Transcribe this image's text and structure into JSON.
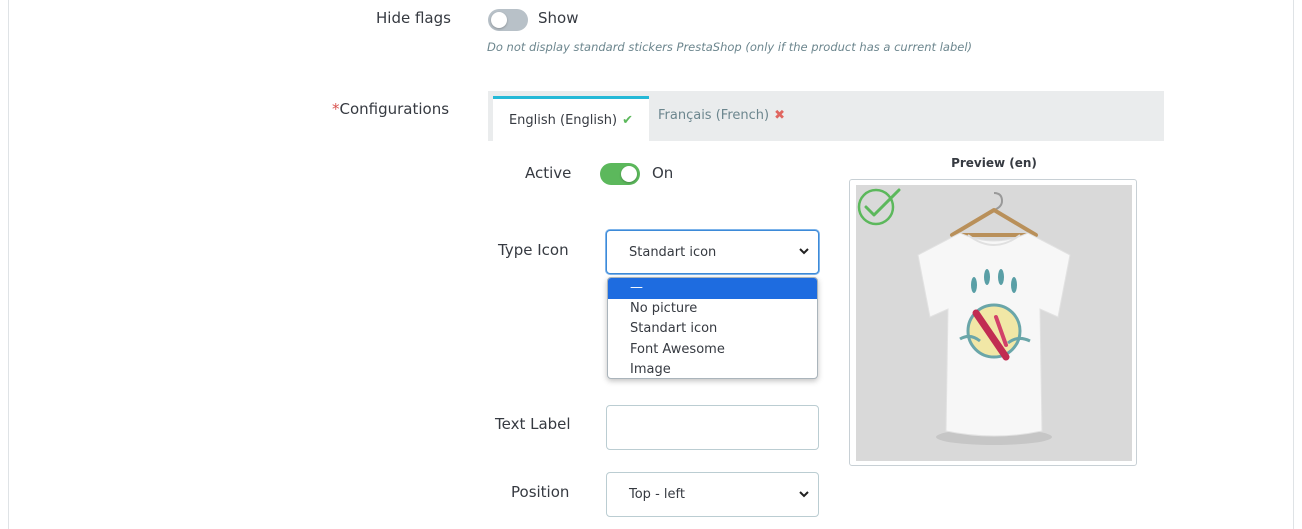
{
  "hide_flags": {
    "label": "Hide flags",
    "state_text": "Show",
    "help": "Do not display standard stickers PrestaShop (only if the product has a current label)"
  },
  "configurations": {
    "required_mark": "*",
    "label": "Configurations",
    "tabs": [
      {
        "label": "English (English)",
        "status": "✔",
        "active": true
      },
      {
        "label": "Français (French)",
        "status": "✖",
        "active": false
      }
    ]
  },
  "active": {
    "label": "Active",
    "state_text": "On"
  },
  "type_icon": {
    "label": "Type Icon",
    "selected": "Standart icon",
    "options": [
      "—",
      "No picture",
      "Standart icon",
      "Font Awesome",
      "Image"
    ]
  },
  "text_label": {
    "label": "Text Label",
    "value": ""
  },
  "position": {
    "label": "Position",
    "selected": "Top - left"
  },
  "preview": {
    "title": "Preview (en)"
  },
  "colors": {
    "accent": "#25b9d7",
    "success": "#5cb85c",
    "danger": "#e06660",
    "focus": "#3d8ad8",
    "option_highlight": "#1e6ce0"
  },
  "icons": {
    "tab_ok": "check-icon",
    "tab_missing": "cross-icon",
    "select_arrow": "chevron-down-icon",
    "sticker": "check-circle-icon"
  }
}
